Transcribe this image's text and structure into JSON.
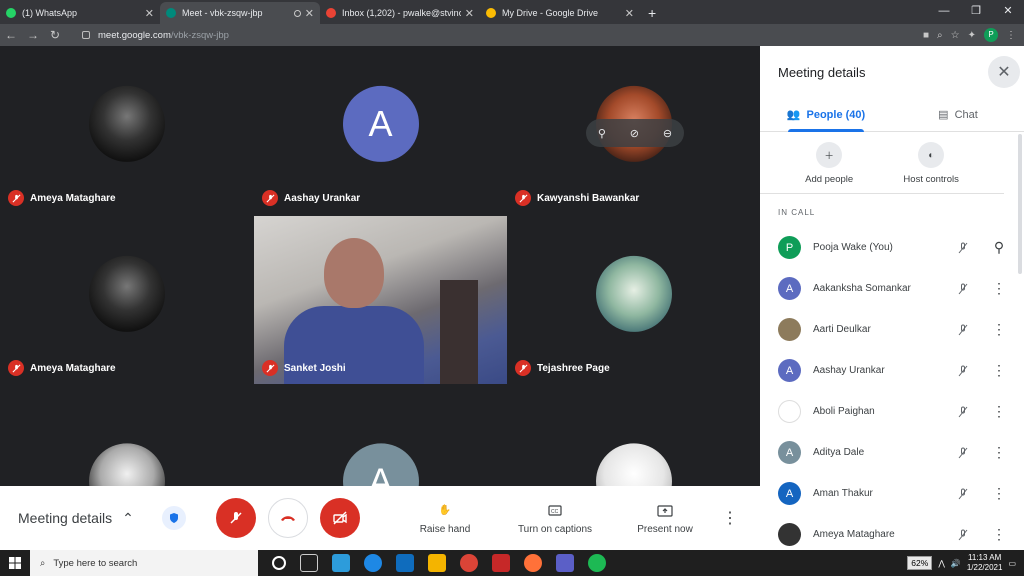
{
  "browser": {
    "tabs": [
      {
        "title": "(1) WhatsApp",
        "color": "#25d366"
      },
      {
        "title": "Meet - vbk-zsqw-jbp",
        "color": "#00897b"
      },
      {
        "title": "Inbox (1,202) - pwalke@stvincen",
        "color": "#ea4335"
      },
      {
        "title": "My Drive - Google Drive",
        "color": "#fbbc04"
      }
    ],
    "url_host": "meet.google.com",
    "url_path": "/vbk-zsqw-jbp"
  },
  "grid": {
    "tiles": [
      {
        "name": "Ameya Mataghare",
        "type": "photo-dark",
        "initial": ""
      },
      {
        "name": "Aashay Urankar",
        "type": "letter",
        "initial": "A",
        "color": "#5c6bc0"
      },
      {
        "name": "Kawyanshi Bawankar",
        "type": "photo-red",
        "initial": ""
      },
      {
        "name": "Ameya Mataghare",
        "type": "photo-dark",
        "initial": ""
      },
      {
        "name": "Sanket Joshi",
        "type": "video",
        "initial": ""
      },
      {
        "name": "Tejashree Page",
        "type": "photo-green",
        "initial": ""
      },
      {
        "name": "",
        "type": "photo-gray",
        "initial": ""
      },
      {
        "name": "",
        "type": "letter",
        "initial": "A",
        "color": "#78909c"
      },
      {
        "name": "",
        "type": "photo-white",
        "initial": ""
      }
    ]
  },
  "bottom": {
    "meeting_details": "Meeting details",
    "raise_hand": "Raise hand",
    "captions": "Turn on captions",
    "present": "Present now"
  },
  "panel": {
    "title": "Meeting details",
    "people_tab": "People (40)",
    "chat_tab": "Chat",
    "add_people": "Add people",
    "host_controls": "Host controls",
    "in_call": "IN CALL",
    "participants": [
      {
        "name": "Pooja Wake (You)",
        "initial": "P",
        "color": "#0f9d58",
        "action": "pin"
      },
      {
        "name": "Aakanksha Somankar",
        "initial": "A",
        "color": "#5c6bc0",
        "action": "more"
      },
      {
        "name": "Aarti Deulkar",
        "initial": "",
        "color": "#8d7b5c",
        "action": "more"
      },
      {
        "name": "Aashay Urankar",
        "initial": "A",
        "color": "#5c6bc0",
        "action": "more"
      },
      {
        "name": "Aboli Paighan",
        "initial": "",
        "color": "#ffffff",
        "action": "more"
      },
      {
        "name": "Aditya Dale",
        "initial": "A",
        "color": "#78909c",
        "action": "more"
      },
      {
        "name": "Aman Thakur",
        "initial": "A",
        "color": "#1565c0",
        "action": "more"
      },
      {
        "name": "Ameya Mataghare",
        "initial": "",
        "color": "#333333",
        "action": "more"
      }
    ]
  },
  "taskbar": {
    "search_placeholder": "Type here to search",
    "battery": "62%",
    "time": "11:13 AM",
    "date": "1/22/2021"
  }
}
